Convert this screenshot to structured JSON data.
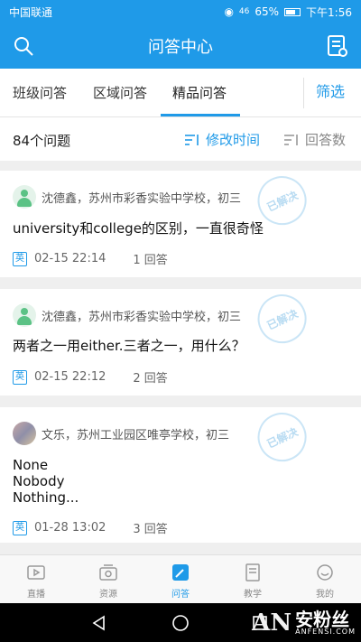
{
  "status_bar": {
    "carrier": "中国联通",
    "signal": "46",
    "battery": "65%",
    "time": "下午1:56"
  },
  "app_bar": {
    "title": "问答中心"
  },
  "tabs": [
    {
      "label": "班级问答"
    },
    {
      "label": "区域问答"
    },
    {
      "label": "精品问答"
    }
  ],
  "filter_label": "筛选",
  "sort_bar": {
    "count": "84个问题",
    "sort_time": "修改时间",
    "sort_answers": "回答数"
  },
  "questions": [
    {
      "user": "沈德鑫，苏州市彩香实验中学校，初三",
      "title": "university和college的区别，一直很奇怪",
      "subject": "英",
      "time": "02-15 22:14",
      "answers": "1 回答",
      "stamp": "已解决"
    },
    {
      "user": "沈德鑫，苏州市彩香实验中学校，初三",
      "title": "两者之一用either.三者之一，用什么？",
      "subject": "英",
      "time": "02-15 22:12",
      "answers": "2 回答",
      "stamp": "已解决"
    },
    {
      "user": "文乐，苏州工业园区唯亭学校，初三",
      "title_lines": [
        "None",
        "Nobody",
        "Nothing..."
      ],
      "subject": "英",
      "time": "01-28 13:02",
      "answers": "3 回答",
      "stamp": "已解决"
    }
  ],
  "bottom_nav": [
    {
      "label": "直播",
      "icon": "live-icon"
    },
    {
      "label": "资源",
      "icon": "resource-icon"
    },
    {
      "label": "问答",
      "icon": "qa-icon"
    },
    {
      "label": "教学",
      "icon": "teaching-icon"
    },
    {
      "label": "我的",
      "icon": "profile-icon"
    }
  ],
  "watermark": {
    "logo": "AN",
    "name": "安粉丝",
    "site": "ANFENSI.COM"
  },
  "colors": {
    "accent": "#1f9ae8",
    "background": "#efefef"
  }
}
